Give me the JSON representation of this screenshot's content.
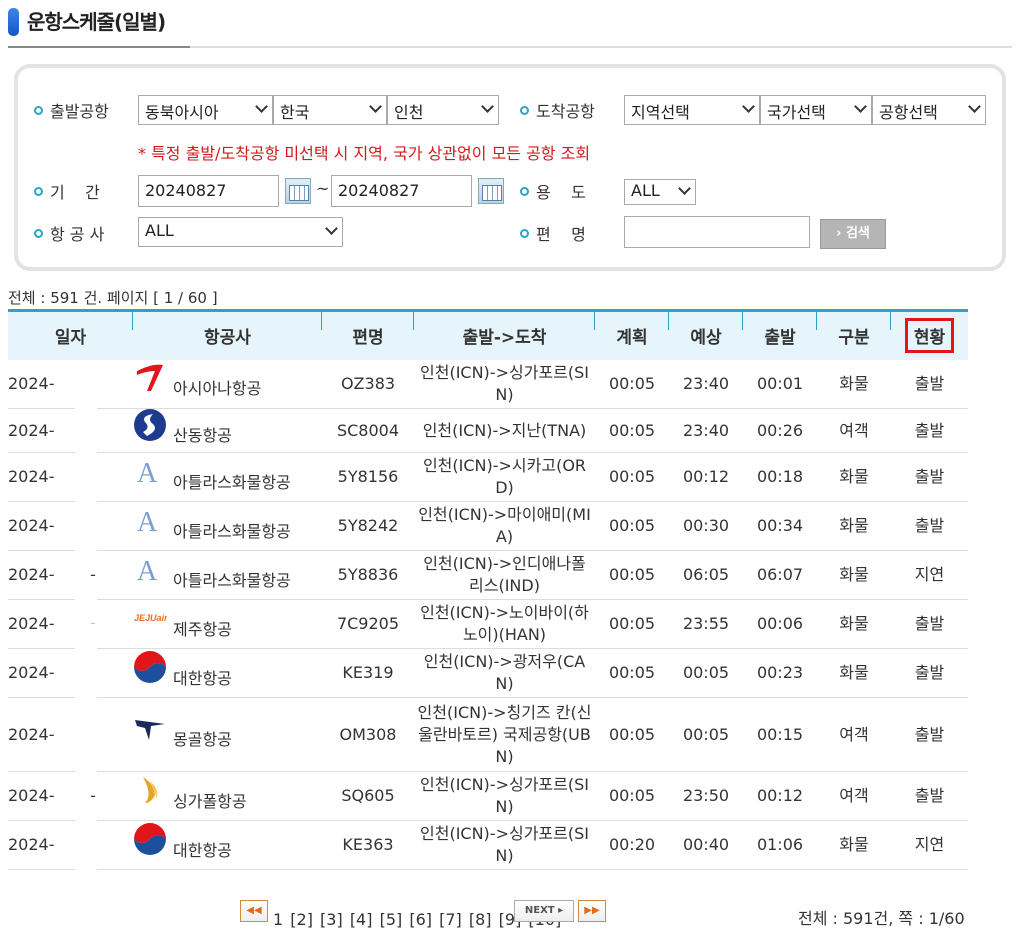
{
  "title": "운항스케줄(일별)",
  "search": {
    "dep_label": "출발공항",
    "dep_region": "동북아시아",
    "dep_country": "한국",
    "dep_airport": "인천",
    "arr_label": "도착공항",
    "arr_region": "지역선택",
    "arr_country": "국가선택",
    "arr_airport": "공항선택",
    "warning": "* 특정 출발/도착공항 미선택 시 지역, 국가 상관없이 모든 공항 조회",
    "period_label": "기    간",
    "date_from": "20240827",
    "date_sep": "~",
    "date_to": "20240827",
    "usage_label": "용    도",
    "usage_value": "ALL",
    "airline_label": "항 공 사",
    "airline_value": "ALL",
    "flight_label": "편    명",
    "flight_value": "",
    "search_button": "› 검색"
  },
  "count_text": "전체 : 591 건. 페이지 [ 1 / 60 ]",
  "table": {
    "headers": [
      "일자",
      "항공사",
      "편명",
      "출발->도착",
      "계획",
      "예상",
      "출발",
      "구분",
      "현황"
    ],
    "rows": [
      {
        "date": "2024-",
        "dash": "-",
        "logo": "asiana-logo",
        "airline": "아시아나항공",
        "flight": "OZ383",
        "route": "인천(ICN)->싱가포르(SIN)",
        "plan": "00:05",
        "est": "23:40",
        "dep": "00:01",
        "type": "화물",
        "status": "출발"
      },
      {
        "date": "2024-",
        "dash": "-",
        "logo": "shandong-logo",
        "airline": "산동항공",
        "flight": "SC8004",
        "route": "인천(ICN)->지난(TNA)",
        "plan": "00:05",
        "est": "23:40",
        "dep": "00:26",
        "type": "여객",
        "status": "출발"
      },
      {
        "date": "2024-",
        "dash": "-",
        "logo": "atlas-logo",
        "airline": "아틀라스화물항공",
        "flight": "5Y8156",
        "route": "인천(ICN)->시카고(ORD)",
        "plan": "00:05",
        "est": "00:12",
        "dep": "00:18",
        "type": "화물",
        "status": "출발"
      },
      {
        "date": "2024-",
        "dash": "-",
        "logo": "atlas-logo",
        "airline": "아틀라스화물항공",
        "flight": "5Y8242",
        "route": "인천(ICN)->마이애미(MIA)",
        "plan": "00:05",
        "est": "00:30",
        "dep": "00:34",
        "type": "화물",
        "status": "출발"
      },
      {
        "date": "2024-",
        "dash": "-",
        "logo": "atlas-logo",
        "airline": "아틀라스화물항공",
        "flight": "5Y8836",
        "route": "인천(ICN)->인디애나폴리스(IND)",
        "plan": "00:05",
        "est": "06:05",
        "dep": "06:07",
        "type": "화물",
        "status": "지연"
      },
      {
        "date": "2024-",
        "dash": "-",
        "logo": "jejuair-logo",
        "airline": "제주항공",
        "flight": "7C9205",
        "route": "인천(ICN)->노이바이(하노이)(HAN)",
        "plan": "00:05",
        "est": "23:55",
        "dep": "00:06",
        "type": "화물",
        "status": "출발"
      },
      {
        "date": "2024-",
        "dash": "-",
        "logo": "koreanair-logo",
        "airline": "대한항공",
        "flight": "KE319",
        "route": "인천(ICN)->광저우(CAN)",
        "plan": "00:05",
        "est": "00:05",
        "dep": "00:23",
        "type": "화물",
        "status": "출발"
      },
      {
        "date": "2024-",
        "dash": "-",
        "logo": "miat-logo",
        "airline": "몽골항공",
        "flight": "OM308",
        "route": "인천(ICN)->칭기즈 칸(신 울란바토르) 국제공항(UBN)",
        "plan": "00:05",
        "est": "00:05",
        "dep": "00:15",
        "type": "여객",
        "status": "출발"
      },
      {
        "date": "2024-",
        "dash": "-",
        "logo": "singapore-logo",
        "airline": "싱가폴항공",
        "flight": "SQ605",
        "route": "인천(ICN)->싱가포르(SIN)",
        "plan": "00:05",
        "est": "23:50",
        "dep": "00:12",
        "type": "여객",
        "status": "출발"
      },
      {
        "date": "2024-",
        "dash": "-",
        "logo": "koreanair-logo",
        "airline": "대한항공",
        "flight": "KE363",
        "route": "인천(ICN)->싱가포르(SIN)",
        "plan": "00:20",
        "est": "00:40",
        "dep": "01:06",
        "type": "화물",
        "status": "지연"
      }
    ]
  },
  "pager": {
    "first": "◀◀",
    "current": "1",
    "pages": [
      "[2]",
      "[3]",
      "[4]",
      "[5]",
      "[6]",
      "[7]",
      "[8]",
      "[9]",
      "[10]"
    ],
    "next": "NEXT ▸",
    "last": "▶▶",
    "total": "전체 : 591건, 쪽 : 1/60"
  },
  "colors": {
    "accent": "#2aa3c6",
    "warning": "#d21a1a",
    "highlight": "#e0161b"
  }
}
